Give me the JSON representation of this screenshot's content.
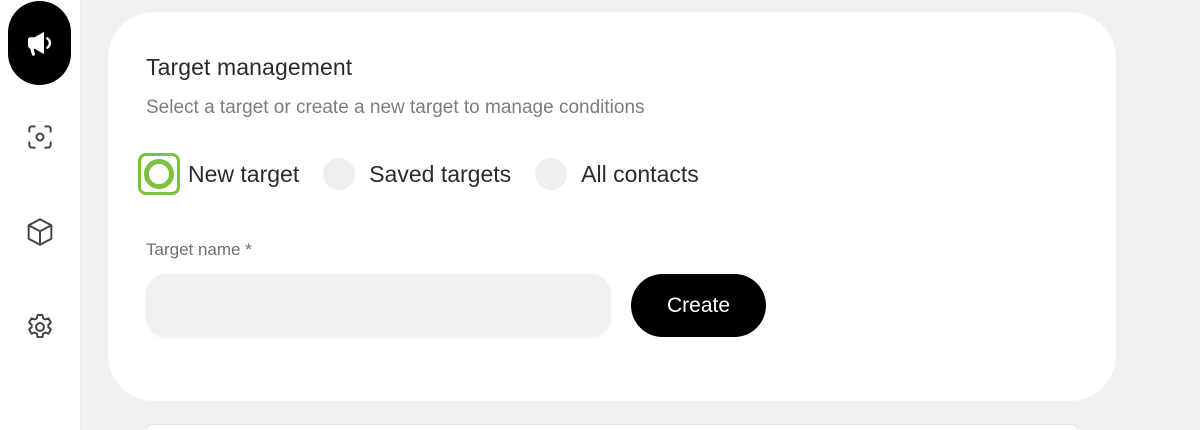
{
  "sidebar": {
    "items": [
      {
        "icon": "megaphone-icon",
        "active": true
      },
      {
        "icon": "scan-icon",
        "active": false
      },
      {
        "icon": "cube-icon",
        "active": false
      },
      {
        "icon": "gear-icon",
        "active": false
      }
    ]
  },
  "card": {
    "title": "Target management",
    "subtitle": "Select a target or create a new target to manage conditions",
    "radio_options": [
      {
        "label": "New target",
        "selected": true
      },
      {
        "label": "Saved targets",
        "selected": false
      },
      {
        "label": "All contacts",
        "selected": false
      }
    ],
    "field_label": "Target name *",
    "field_value": "",
    "field_placeholder": "",
    "create_label": "Create"
  },
  "colors": {
    "accent": "#7cc13f",
    "primary_button": "#000000",
    "background": "#f1f1f1",
    "card": "#ffffff"
  }
}
